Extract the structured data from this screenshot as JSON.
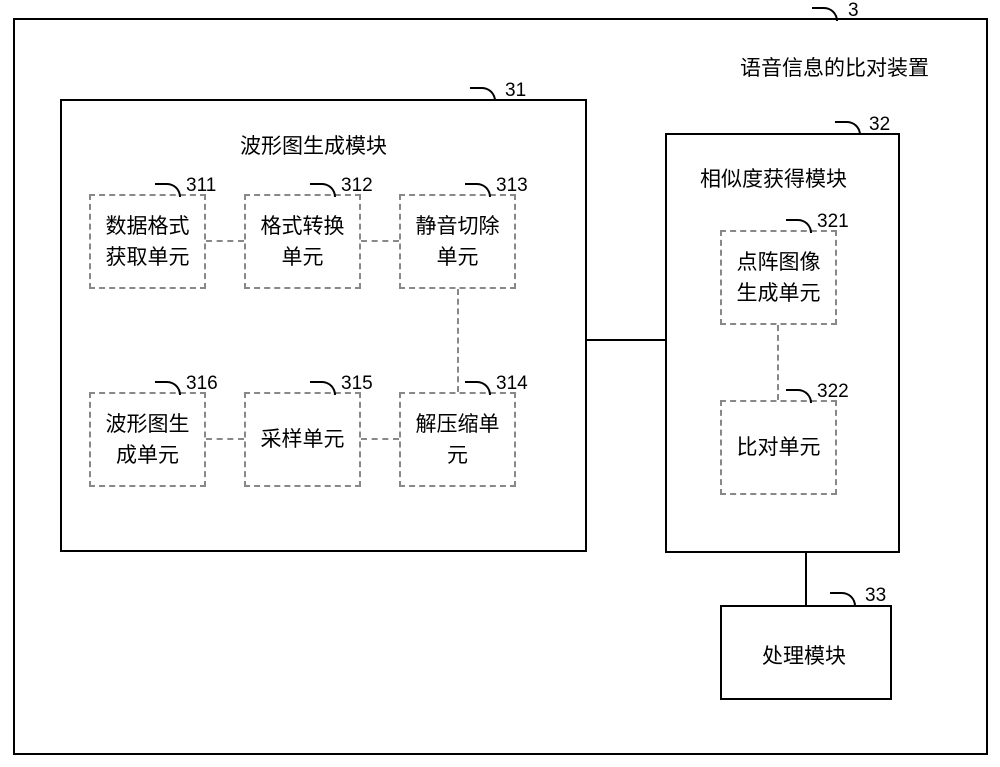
{
  "labels": {
    "outer": {
      "num": "3",
      "title": "语音信息的比对装置"
    },
    "m31": {
      "num": "31",
      "title": "波形图生成模块"
    },
    "m32": {
      "num": "32",
      "title": "相似度获得模块"
    },
    "m33": {
      "num": "33",
      "title": "处理模块"
    },
    "u311": {
      "num": "311",
      "l1": "数据格式",
      "l2": "获取单元"
    },
    "u312": {
      "num": "312",
      "l1": "格式转换",
      "l2": "单元"
    },
    "u313": {
      "num": "313",
      "l1": "静音切除",
      "l2": "单元"
    },
    "u314": {
      "num": "314",
      "l1": "解压缩单",
      "l2": "元"
    },
    "u315": {
      "num": "315",
      "l1": "采样单元",
      "l2": ""
    },
    "u316": {
      "num": "316",
      "l1": "波形图生",
      "l2": "成单元"
    },
    "u321": {
      "num": "321",
      "l1": "点阵图像",
      "l2": "生成单元"
    },
    "u322": {
      "num": "322",
      "l1": "比对单元",
      "l2": ""
    }
  }
}
